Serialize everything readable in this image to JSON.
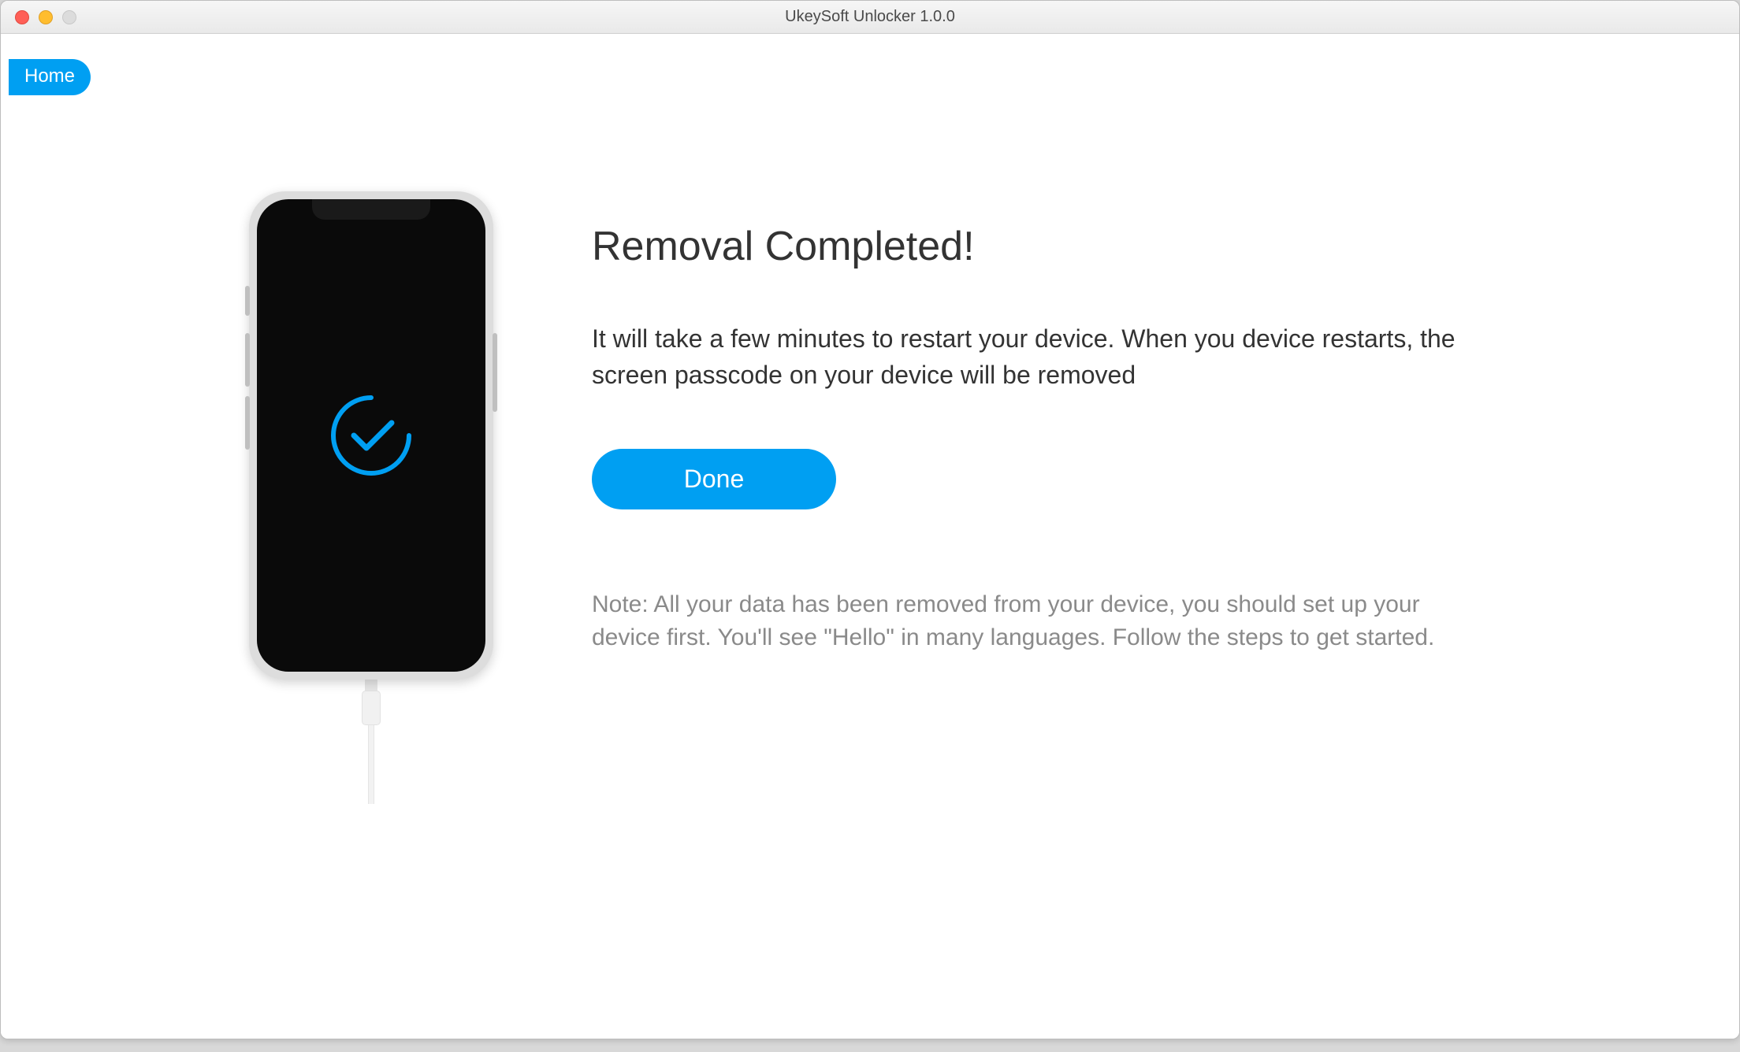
{
  "window": {
    "title": "UkeySoft Unlocker 1.0.0"
  },
  "nav": {
    "home_label": "Home"
  },
  "main": {
    "heading": "Removal Completed!",
    "body": "It will take a few minutes to restart your device. When you device restarts, the screen passcode on your device will be removed",
    "done_label": "Done",
    "note": "Note: All your data has been removed from your device, you should set up your device first. You'll see \"Hello\" in many languages. Follow the steps to get started."
  },
  "colors": {
    "accent": "#009ff2"
  }
}
